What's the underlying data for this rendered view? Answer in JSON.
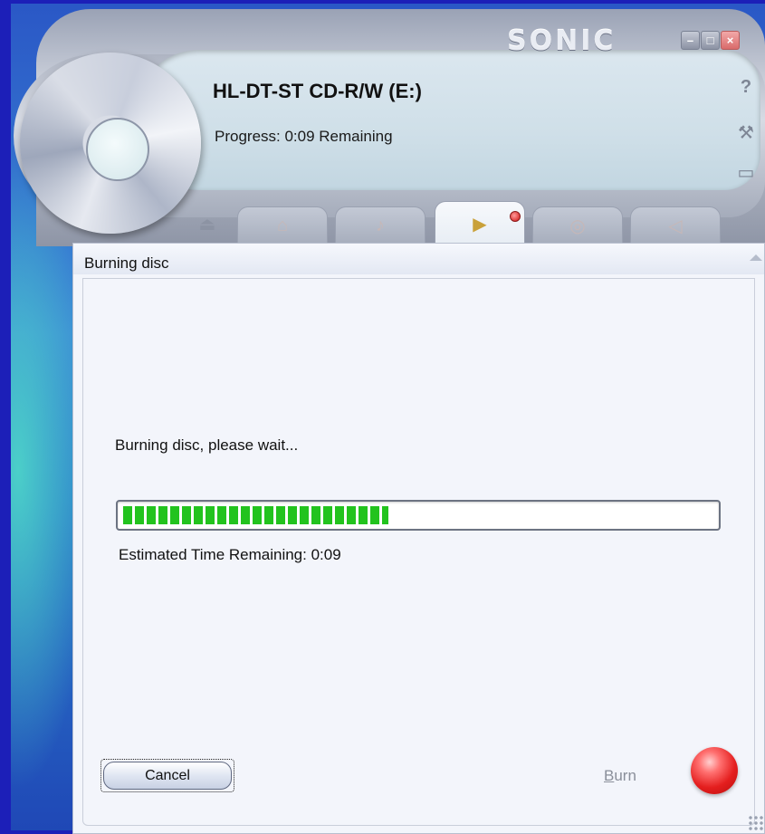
{
  "player": {
    "brand": "SONIC",
    "drive_name": "HL-DT-ST CD-R/W (E:)",
    "progress_status": "Progress: 0:09 Remaining",
    "window_buttons": {
      "minimize": "–",
      "maximize": "□",
      "close": "×"
    },
    "side_icons": {
      "help": "?",
      "tools": "⚒",
      "folder": "▭"
    },
    "tabs": [
      {
        "icon": "home-icon",
        "glyph": "⌂"
      },
      {
        "icon": "music-icon",
        "glyph": "♪"
      },
      {
        "icon": "burn-folder-icon",
        "glyph": "▶",
        "active": true
      },
      {
        "icon": "disc-icon",
        "glyph": "◎"
      },
      {
        "icon": "speaker-icon",
        "glyph": "◁"
      }
    ],
    "eject_glyph": "⏏"
  },
  "panel": {
    "title": "Burning disc",
    "status_message": "Burning disc, please wait...",
    "progress_fraction": 0.45,
    "eta_text": "Estimated Time Remaining: 0:09",
    "cancel_label": "Cancel",
    "burn_label_underlined": "B",
    "burn_label_rest": "urn"
  },
  "colors": {
    "progress_green": "#22c31e",
    "burn_orb": "#e41e1e",
    "desktop_blue": "#1e2fc4"
  }
}
